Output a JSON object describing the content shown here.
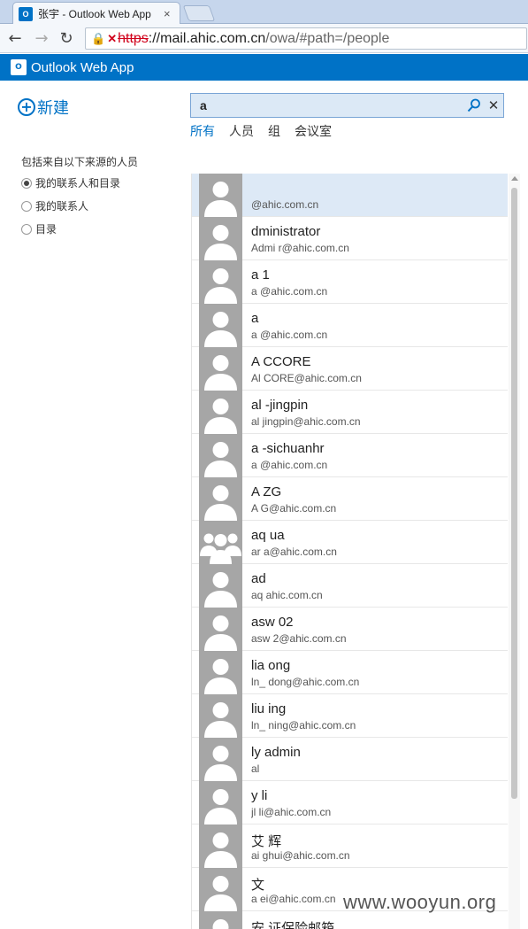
{
  "browser": {
    "tab_title": "张宇 - Outlook Web App",
    "url_scheme": "https",
    "url_host": "://mail.ahic.com.cn",
    "url_path": "/owa/#path=/people"
  },
  "app": {
    "title": "Outlook Web App"
  },
  "new_button": {
    "label": "新建"
  },
  "sources": {
    "heading": "包括来自以下来源的人员",
    "options": [
      {
        "label": "我的联系人和目录",
        "checked": true
      },
      {
        "label": "我的联系人",
        "checked": false
      },
      {
        "label": "目录",
        "checked": false
      }
    ]
  },
  "search": {
    "value": "a",
    "filters": [
      {
        "label": "所有",
        "active": true
      },
      {
        "label": "人员",
        "active": false
      },
      {
        "label": "组",
        "active": false
      },
      {
        "label": "会议室",
        "active": false
      }
    ]
  },
  "results": [
    {
      "name": "",
      "email": "@ahic.com.cn",
      "avatar": "person",
      "selected": true
    },
    {
      "name": "dministrator",
      "email": "Admi            r@ahic.com.cn",
      "avatar": "person"
    },
    {
      "name": "a    1",
      "email": "a      @ahic.com.cn",
      "avatar": "person"
    },
    {
      "name": "a",
      "email": "a      @ahic.com.cn",
      "avatar": "person"
    },
    {
      "name": "A     CCORE",
      "email": "Al     CORE@ahic.com.cn",
      "avatar": "person"
    },
    {
      "name": "al     -jingpin",
      "email": "al     jingpin@ahic.com.cn",
      "avatar": "person"
    },
    {
      "name": "a     -sichuanhr",
      "email": "a                   @ahic.com.cn",
      "avatar": "person"
    },
    {
      "name": "A     ZG",
      "email": "A      G@ahic.com.cn",
      "avatar": "person"
    },
    {
      "name": "aq     ua",
      "email": "ar      a@ahic.com.cn",
      "avatar": "group"
    },
    {
      "name": "ad",
      "email": "aq      ahic.com.cn",
      "avatar": "person"
    },
    {
      "name": "asw     02",
      "email": "asw     2@ahic.com.cn",
      "avatar": "person"
    },
    {
      "name": "lia     ong",
      "email": "ln_     dong@ahic.com.cn",
      "avatar": "person"
    },
    {
      "name": "liu     ing",
      "email": "ln_     ning@ahic.com.cn",
      "avatar": "person"
    },
    {
      "name": "ly     admin",
      "email": "al",
      "avatar": "person"
    },
    {
      "name": "y     li",
      "email": "jl     li@ahic.com.cn",
      "avatar": "person"
    },
    {
      "name": "艾     辉",
      "email": "ai     ghui@ahic.com.cn",
      "avatar": "person"
    },
    {
      "name": "文",
      "email": "a       ei@ahic.com.cn",
      "avatar": "person"
    },
    {
      "name": "安     证保险邮箱",
      "email": "",
      "avatar": "person"
    }
  ],
  "watermark": "www.wooyun.org",
  "colors": {
    "brand": "#0072c6",
    "selected_row": "#dde9f6",
    "avatar_bg": "#a6a6a6"
  }
}
